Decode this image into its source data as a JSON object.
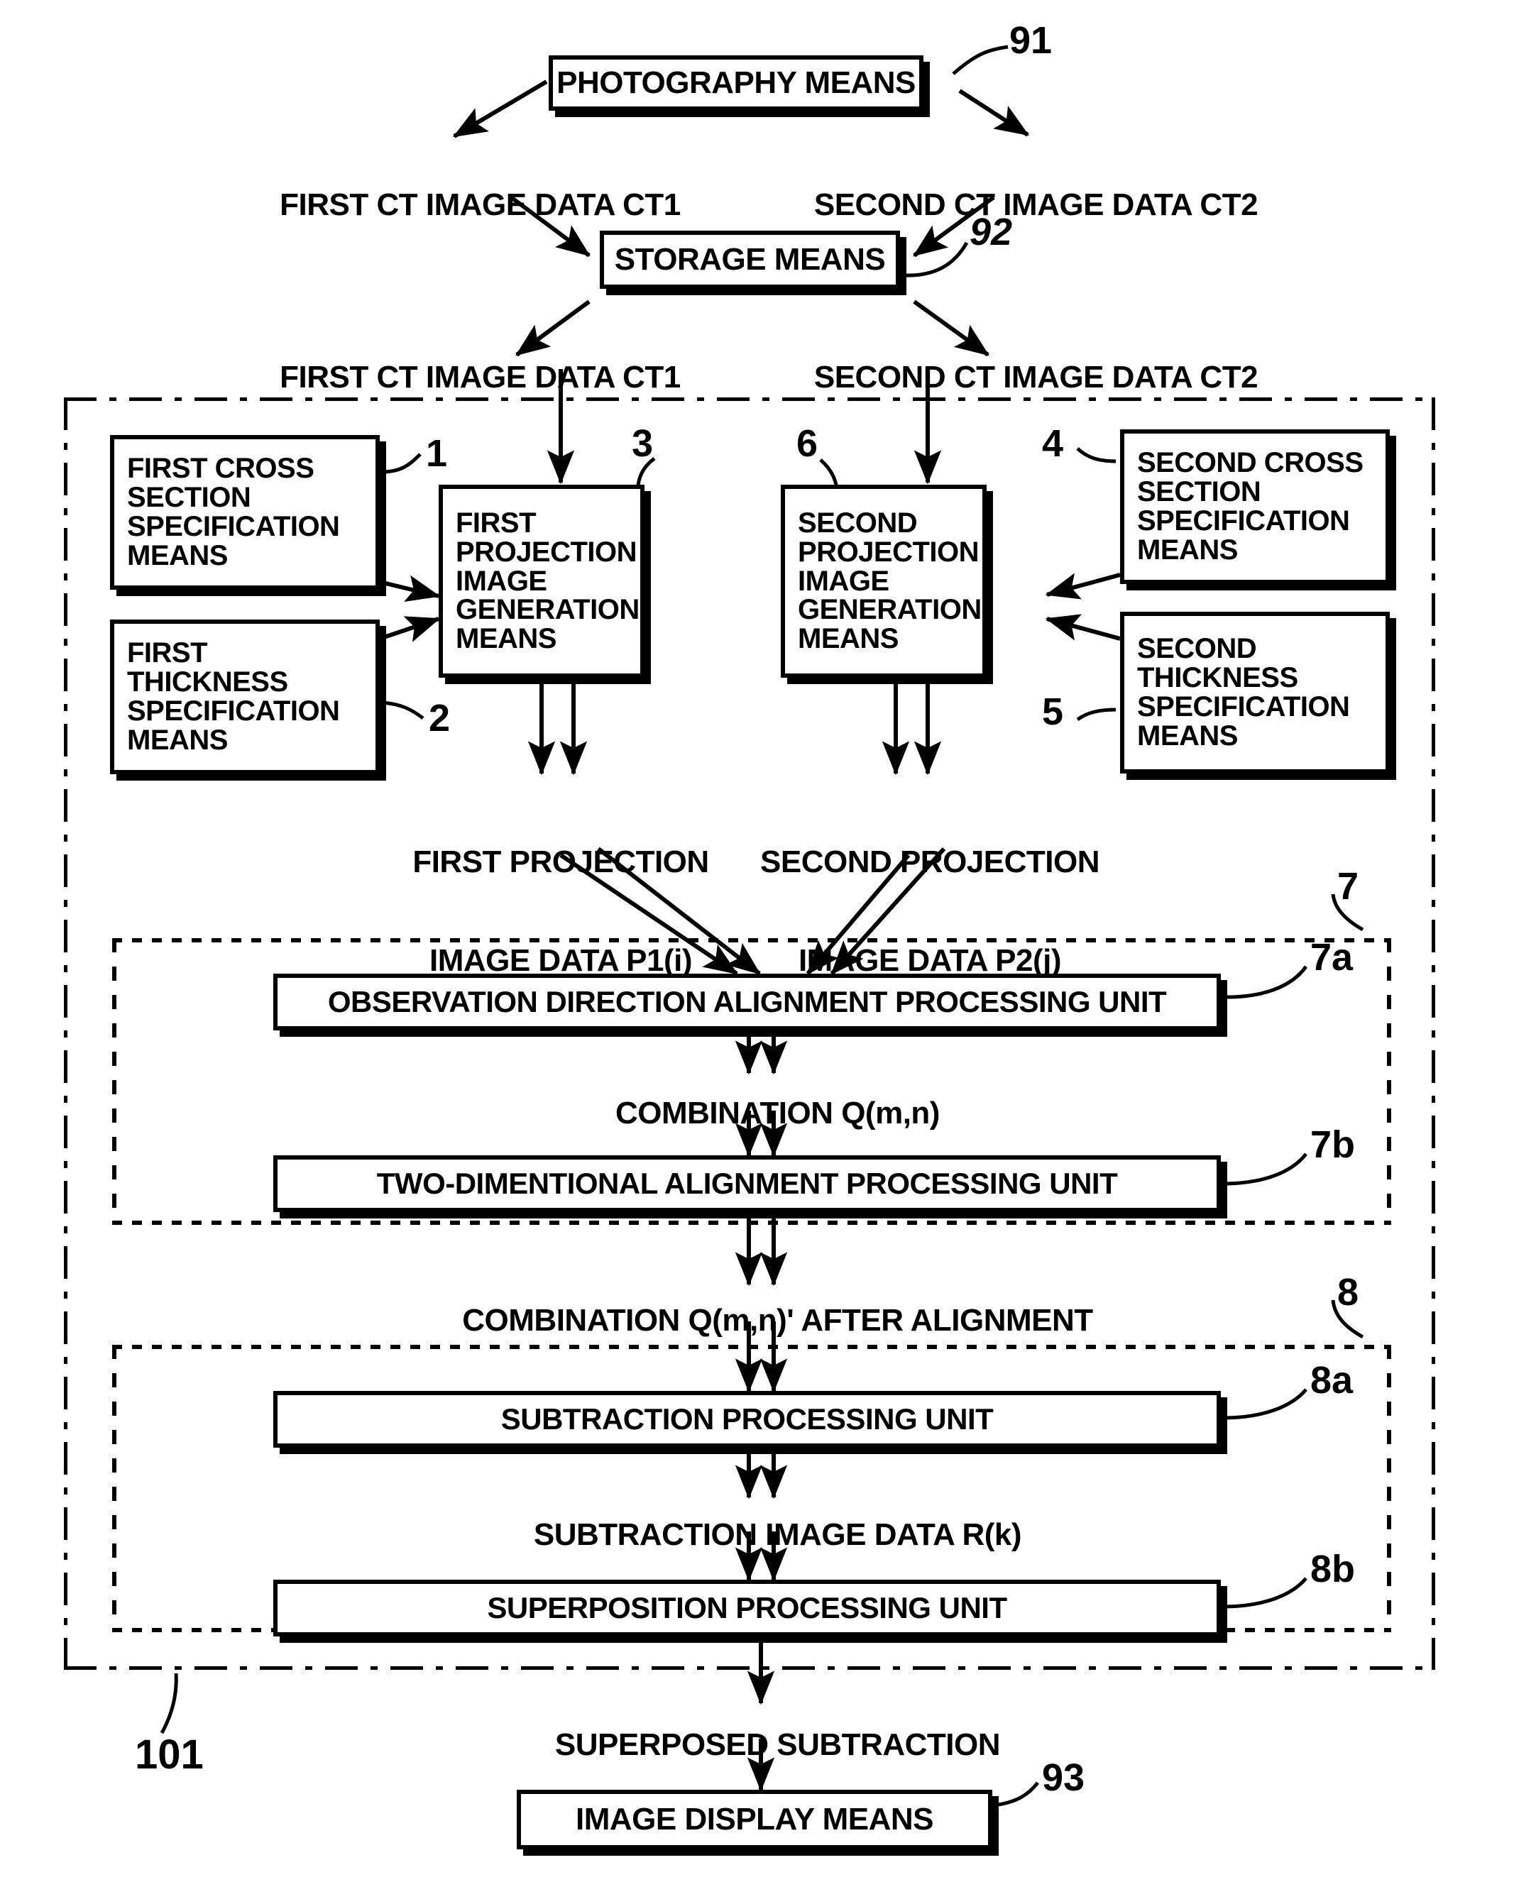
{
  "figure": {
    "type": "patent-block-diagram",
    "title": "CT subtraction image processing system block diagram"
  },
  "blocks": {
    "photography_means": "PHOTOGRAPHY MEANS",
    "storage_means": "STORAGE MEANS",
    "first_cross_section": "FIRST CROSS\nSECTION\nSPECIFICATION\nMEANS",
    "first_thickness": "FIRST\nTHICKNESS\nSPECIFICATION\nMEANS",
    "first_projection_gen": "FIRST\nPROJECTION\nIMAGE\nGENERATION\nMEANS",
    "second_projection_gen": "SECOND\nPROJECTION\nIMAGE\nGENERATION\nMEANS",
    "second_cross_section": "SECOND CROSS\nSECTION\nSPECIFICATION\nMEANS",
    "second_thickness": "SECOND\nTHICKNESS\nSPECIFICATION\nMEANS",
    "observation_alignment": "OBSERVATION DIRECTION ALIGNMENT PROCESSING UNIT",
    "two_dimensional_alignment": "TWO-DIMENTIONAL ALIGNMENT PROCESSING UNIT",
    "subtraction_unit": "SUBTRACTION PROCESSING UNIT",
    "superposition_unit": "SUPERPOSITION PROCESSING UNIT",
    "image_display_means": "IMAGE DISPLAY MEANS"
  },
  "flow_labels": {
    "ct1_top": "FIRST CT IMAGE DATA CT1",
    "ct2_top": "SECOND CT IMAGE DATA CT2",
    "ct1_bottom": "FIRST CT IMAGE DATA CT1",
    "ct2_bottom": "SECOND CT IMAGE DATA CT2",
    "p1_line1": "FIRST PROJECTION",
    "p1_line2": "IMAGE DATA P1(i)",
    "p2_line1": "SECOND PROJECTION",
    "p2_line2": "IMAGE DATA P2(j)",
    "combination_q": "COMBINATION Q(m,n)",
    "combination_q_after": "COMBINATION Q(m,n)' AFTER ALIGNMENT",
    "subtraction_image_data": "SUBTRACTION IMAGE DATA R(k)",
    "superposed_subtraction": "SUPERPOSED SUBTRACTION"
  },
  "reference_numerals": {
    "n91": "91",
    "n92": "92",
    "n93": "93",
    "n1": "1",
    "n2": "2",
    "n3": "3",
    "n4": "4",
    "n5": "5",
    "n6": "6",
    "n7": "7",
    "n7a": "7a",
    "n7b": "7b",
    "n8": "8",
    "n8a": "8a",
    "n8b": "8b",
    "n101": "101"
  },
  "colors": {
    "ink": "#000000",
    "paper": "#ffffff"
  }
}
